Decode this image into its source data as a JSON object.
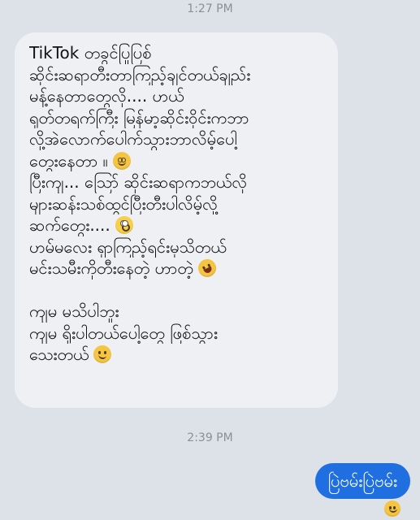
{
  "thread": {
    "timestamp_1": "1:27 PM",
    "timestamp_2": "2:39 PM"
  },
  "incoming_message": {
    "lines": [
      "TikTok တခွင်ပြုပြစ်",
      "ဆိုင်းဆရာတီးတာကြည့်ချင်တယ်ချည်း",
      "မန့်နေတာတွေလို.... ဟယ်",
      "ရုတ်တရက်ကြီး မြန်မာ့ဆိုင်းဝိုင်းကဘာ",
      "လို့အဲလောက်ပေါက်သွားဘာလိမ့်ပေါ့",
      "တွေးနေတာ ။",
      "ပြီးကျ... သြော် ဆိုင်းဆရာကဘယ်လို",
      "များဆန်းသစ်ထွင်ပြီးတီးပါလိမ့်လို့",
      "ဆက်တွေး....",
      "ဟမ်မလေး ရှာကြည့်ရင်းမှသိတယ်",
      "မင်းသမီးကိုတီးနေတဲ့ ဟာတဲ့",
      "",
      "ကျမ မသိပါဘူး",
      "ကျမ ရိုးပါတယ်ပေါ့တွေ ဖြစ်သွား",
      "သေးတယ်"
    ],
    "emoji_names": {
      "line_6": "dizzy-face-icon",
      "line_9": "rolling-eyes-icon",
      "line_11": "rofl-icon",
      "line_15": "woozy-face-icon"
    }
  },
  "outgoing_message": {
    "text": "ပြဲဗမ်းပြဲဗမ်း",
    "reaction_emoji": "grinning-face-icon"
  },
  "colors": {
    "background": "#dde1e8",
    "incoming_bubble": "#eef0f4",
    "outgoing_bubble": "#1f6fe0",
    "timestamp_text": "#8a8f98"
  }
}
